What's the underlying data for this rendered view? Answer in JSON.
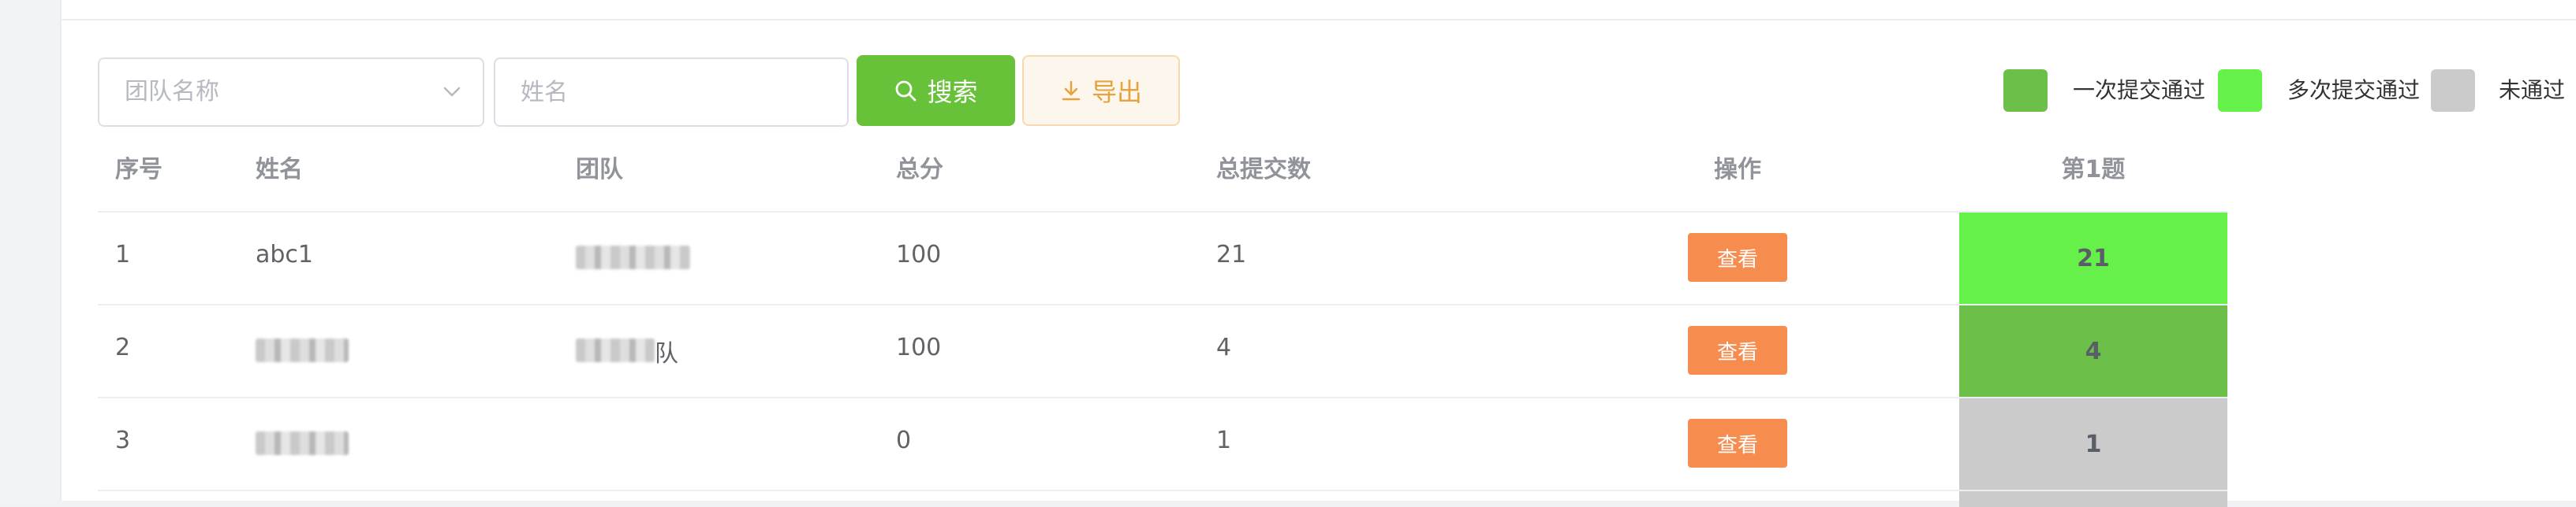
{
  "toolbar": {
    "team_select_placeholder": "团队名称",
    "name_input_placeholder": "姓名",
    "search_label": "搜索",
    "export_label": "导出"
  },
  "legend": [
    {
      "label": "一次提交通过",
      "color": "#6cc04a"
    },
    {
      "label": "多次提交通过",
      "color": "#66f04a"
    },
    {
      "label": "未通过",
      "color": "#cbcbcb"
    }
  ],
  "table": {
    "headers": {
      "index": "序号",
      "name": "姓名",
      "team": "团队",
      "score": "总分",
      "submissions": "总提交数",
      "action": "操作",
      "q1": "第1题"
    },
    "action_label": "查看",
    "rows": [
      {
        "index": "1",
        "name": "abc1",
        "team": "",
        "score": "100",
        "submissions": "21",
        "q1": "21",
        "q1_status": "multiple",
        "q1_color": "#66f04a"
      },
      {
        "index": "2",
        "name": "",
        "team": "队",
        "score": "100",
        "submissions": "4",
        "q1": "4",
        "q1_status": "first",
        "q1_color": "#6cc04a"
      },
      {
        "index": "3",
        "name": "",
        "team": "",
        "score": "0",
        "submissions": "1",
        "q1": "1",
        "q1_status": "failed",
        "q1_color": "#cbcbcb"
      }
    ]
  },
  "colors": {
    "search_button": "#67c23a",
    "export_text": "#e6a23c",
    "view_button": "#f78c4f"
  }
}
